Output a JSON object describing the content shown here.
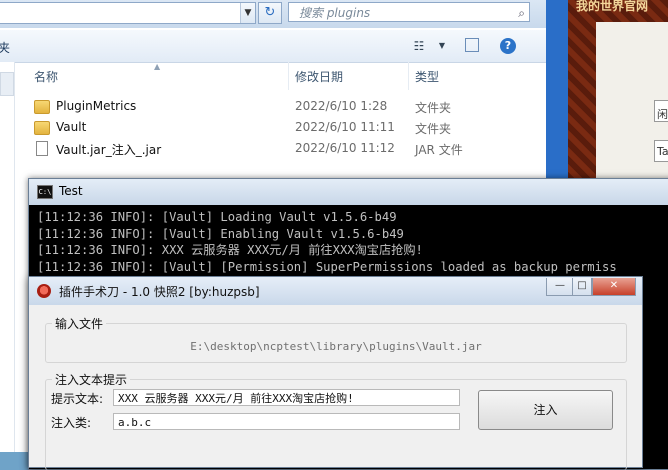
{
  "explorer": {
    "search_placeholder": "搜索 plugins",
    "toolbar_partial_label": "夹",
    "columns": [
      "名称",
      "修改日期",
      "类型"
    ],
    "files": [
      {
        "name": "PluginMetrics",
        "date": "2022/6/10 1:28",
        "type": "文件夹",
        "icon": "folder-icon"
      },
      {
        "name": "Vault",
        "date": "2022/6/10 11:11",
        "type": "文件夹",
        "icon": "folder-icon"
      },
      {
        "name": "Vault.jar_注入_.jar",
        "date": "2022/6/10 11:12",
        "type": "JAR 文件",
        "icon": "file-icon"
      }
    ]
  },
  "background_site": {
    "title": "我的世界官网",
    "fragments": [
      "闲",
      "Ta"
    ]
  },
  "console": {
    "title": "Test",
    "lines": [
      "[11:12:36 INFO]: [Vault] Loading Vault v1.5.6-b49",
      "[11:12:36 INFO]: [Vault] Enabling Vault v1.5.6-b49",
      "[11:12:36 INFO]: XXX 云服务器 XXX元/月 前往XXX淘宝店抢购!",
      "[11:12:36 INFO]: [Vault] [Permission] SuperPermissions loaded as backup permiss"
    ],
    "behind_fragments": [
      "ew",
      "ac",
      "op"
    ]
  },
  "tool": {
    "title": "插件手术刀 - 1.0 快照2 [by:huzpsb]",
    "input_group": {
      "legend": "输入文件",
      "path": "E:\\desktop\\ncptest\\library\\plugins\\Vault.jar"
    },
    "hint_group": {
      "legend": "注入文本提示",
      "hint_label": "提示文本:",
      "hint_value": "XXX 云服务器 XXX元/月 前往XXX淘宝店抢购!",
      "class_label": "注入类:",
      "class_value": "a.b.c",
      "inject_button": "注入"
    }
  }
}
